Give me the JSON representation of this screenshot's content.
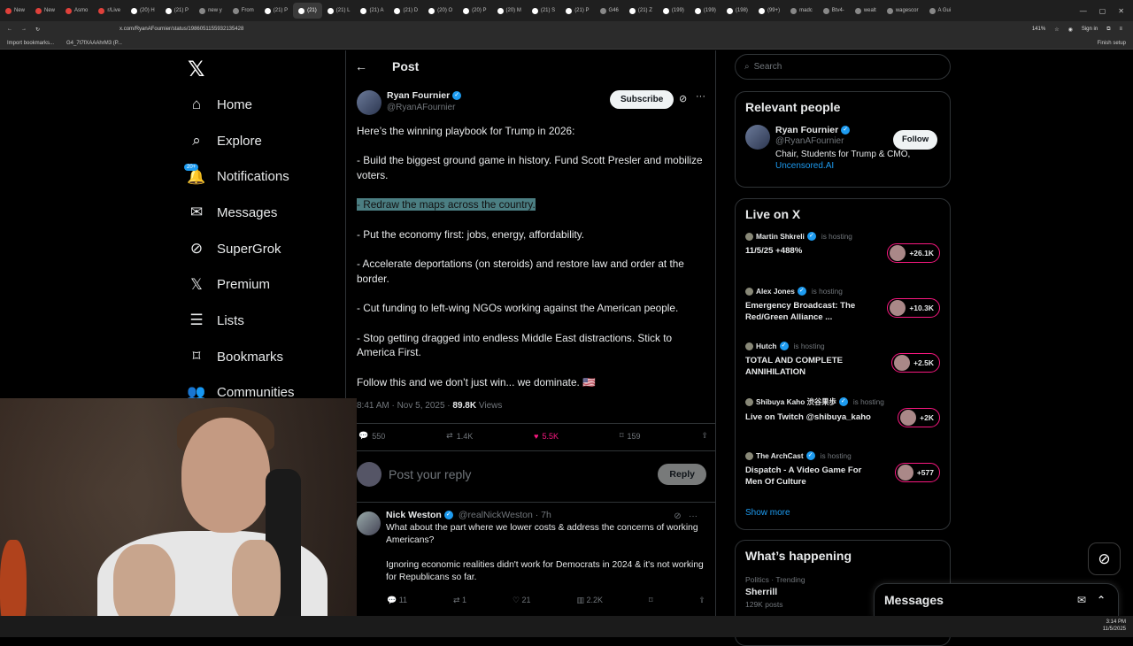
{
  "browser": {
    "tabs": [
      "New",
      "New",
      "Asmo",
      "r/Live",
      "(20) H",
      "(21) P",
      "new y",
      "From",
      "(21) P",
      "(21)",
      "(21) L",
      "(21) A",
      "(21) D",
      "(20) O",
      "(20) P",
      "(20) M",
      "(21) S",
      "(21) P",
      "G46",
      "(21) Z",
      "(199)",
      "(199)",
      "(198)",
      "(99+)",
      "madc",
      "Btv4-",
      "wealt",
      "wagescor",
      "A Gui"
    ],
    "active_tab_index": 9,
    "url": "x.com/RyanAFournier/status/1986051155932135428",
    "zoom": "141%",
    "signin": "Sign in",
    "bookmarks": [
      "Import bookmarks...",
      "G4_7t7fXAAAhrM3 (P..."
    ],
    "finish_setup": "Finish setup"
  },
  "nav": {
    "items": [
      {
        "label": "Home",
        "icon": "home-icon"
      },
      {
        "label": "Explore",
        "icon": "search-icon"
      },
      {
        "label": "Notifications",
        "icon": "bell-icon",
        "badge": "20+"
      },
      {
        "label": "Messages",
        "icon": "mail-icon"
      },
      {
        "label": "SuperGrok",
        "icon": "grok-icon"
      },
      {
        "label": "Premium",
        "icon": "x-icon"
      },
      {
        "label": "Lists",
        "icon": "list-icon"
      },
      {
        "label": "Bookmarks",
        "icon": "bookmark-icon"
      },
      {
        "label": "Communities",
        "icon": "people-icon"
      }
    ]
  },
  "post": {
    "header_title": "Post",
    "author_name": "Ryan Fournier",
    "author_handle": "@RyanAFournier",
    "subscribe_label": "Subscribe",
    "paragraphs": [
      "Here’s the winning playbook for Trump in 2026:",
      "- Build the biggest ground game in history. Fund Scott Presler and mobilize voters.",
      "- Redraw the maps across the country.",
      "- Put the economy first: jobs, energy, affordability.",
      "- Accelerate deportations (on steroids) and restore law and order at the border.",
      "- Cut funding to left-wing NGOs working against the American people.",
      "- Stop getting dragged into endless Middle East distractions. Stick to America First.",
      "Follow this and we don’t just win... we dominate. 🇺🇸"
    ],
    "timestamp": "8:41 AM · Nov 5, 2025 · ",
    "views_count": "89.8K",
    "views_label": " Views",
    "stats": {
      "replies": "550",
      "reposts": "1.4K",
      "likes": "5.5K",
      "bookmarks": "159"
    },
    "reply_placeholder": "Post your reply",
    "reply_button": "Reply"
  },
  "reply": {
    "name": "Nick Weston",
    "handle_time": "@realNickWeston · 7h",
    "paragraphs": [
      "What about the part where we lower costs & address the concerns of working Americans?",
      "Ignoring economic realities didn't work for Democrats in 2024 & it's not working for Republicans so far."
    ],
    "stats": {
      "replies": "11",
      "reposts": "1",
      "likes": "21",
      "views": "2.2K"
    }
  },
  "search_placeholder": "Search",
  "relevant": {
    "title": "Relevant people",
    "name": "Ryan Fournier",
    "handle": "@RyanAFournier",
    "bio": "Chair, Students for Trump & CMO,",
    "bio_link": "Uncensored.AI",
    "follow_label": "Follow"
  },
  "live": {
    "title": "Live on X",
    "is_hosting": "is hosting",
    "items": [
      {
        "host": "Martin Shkreli",
        "title": "11/5/25 +488%",
        "count": "+26.1K"
      },
      {
        "host": "Alex Jones",
        "title": "Emergency Broadcast: The Red/Green Alliance ...",
        "count": "+10.3K"
      },
      {
        "host": "Hutch",
        "title": "TOTAL AND COMPLETE ANNIHILATION",
        "count": "+2.5K"
      },
      {
        "host": "Shibuya Kaho 渋谷果歩",
        "title": "Live on Twitch @shibuya_kaho",
        "count": "+2K"
      },
      {
        "host": "The ArchCast",
        "title": "Dispatch - A Video Game For Men Of Culture",
        "count": "+577"
      }
    ],
    "show_more": "Show more"
  },
  "happening": {
    "title": "What’s happening",
    "category": "Politics · Trending",
    "trend": "Sherrill",
    "posts": "129K posts"
  },
  "messages_bar": {
    "label": "Messages"
  },
  "taskbar": {
    "time": "3:14 PM",
    "date": "11/5/2025"
  },
  "colors": {
    "accent": "#1d9bf0",
    "like": "#f91880",
    "highlight": "#4b7e82"
  }
}
